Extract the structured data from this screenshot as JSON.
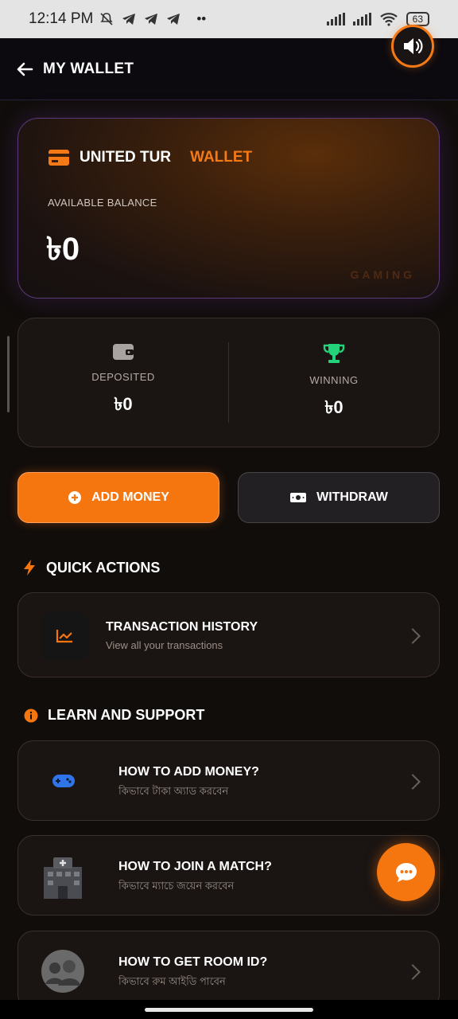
{
  "status_bar": {
    "time": "12:14 PM",
    "battery": "63"
  },
  "header": {
    "title": "MY WALLET"
  },
  "wallet_card": {
    "brand": "UNITED TUR",
    "brand_accent": "WALLET",
    "balance_label": "AVAILABLE BALANCE",
    "balance": "৳0",
    "watermark": "GAMING"
  },
  "stats": {
    "deposited_label": "DEPOSITED",
    "deposited_value": "৳0",
    "winning_label": "WINNING",
    "winning_value": "৳0"
  },
  "actions": {
    "add_money": "ADD MONEY",
    "withdraw": "WITHDRAW"
  },
  "quick_actions": {
    "title": "QUICK ACTIONS",
    "items": [
      {
        "title": "TRANSACTION HISTORY",
        "subtitle": "View all your transactions",
        "icon": "chart-line-icon"
      }
    ]
  },
  "learn_support": {
    "title": "LEARN AND SUPPORT",
    "items": [
      {
        "title": "HOW TO ADD MONEY?",
        "subtitle": "কিভাবে টাকা অ্যাড করবেন",
        "icon": "gamepad-icon"
      },
      {
        "title": "HOW TO JOIN A MATCH?",
        "subtitle": "কিভাবে ম্যাচে জয়েন করবেন",
        "icon": "hospital-building-icon"
      },
      {
        "title": "HOW TO GET ROOM ID?",
        "subtitle": "কিভাবে রুম আইডি পাবেন",
        "icon": "group-avatar-icon"
      }
    ]
  },
  "colors": {
    "accent": "#f5760f",
    "trophy": "#22d37a",
    "background": "#110d0b"
  }
}
